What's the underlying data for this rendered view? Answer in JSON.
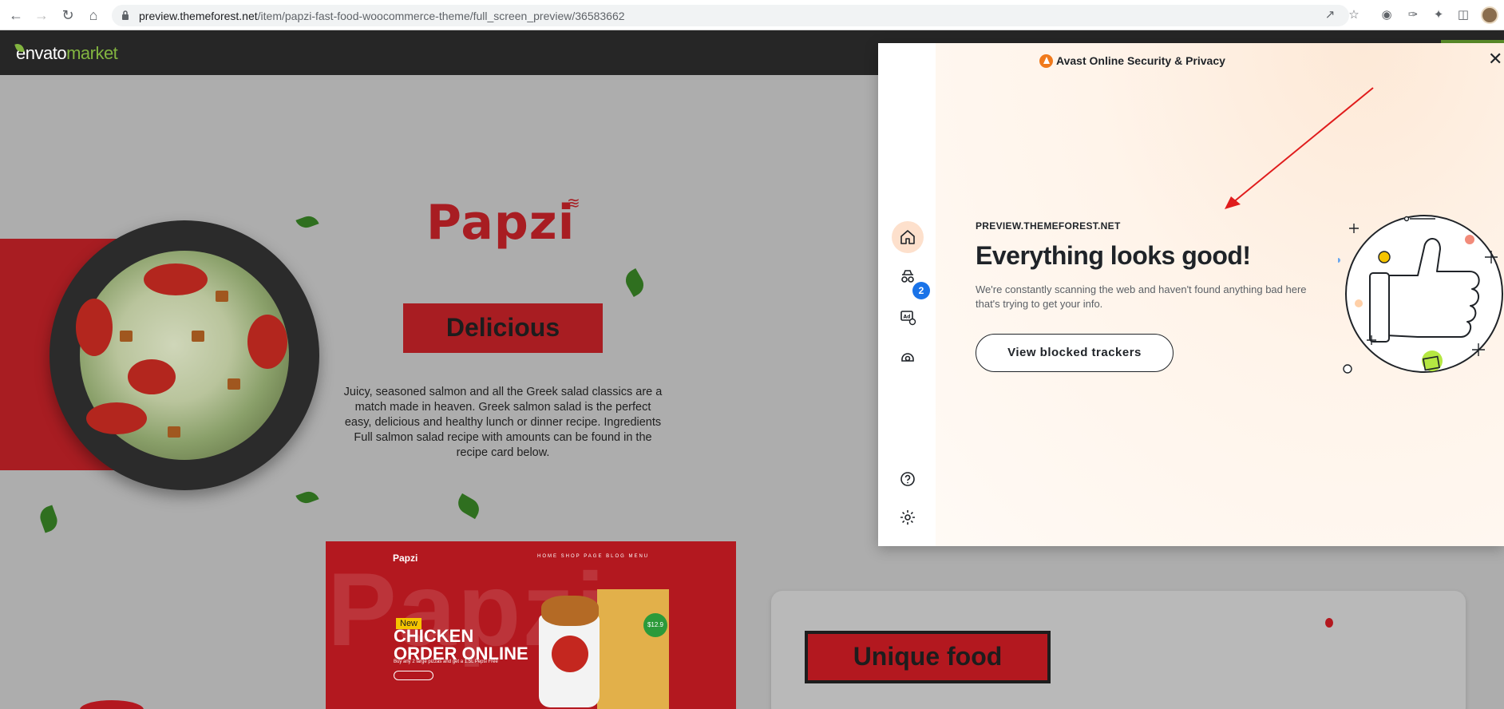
{
  "browser": {
    "url_host": "preview.themeforest.net",
    "url_path": "/item/papzi-fast-food-woocommerce-theme/full_screen_preview/36583662",
    "icons": [
      "back-icon",
      "forward-icon",
      "reload-icon",
      "home-icon",
      "lock-icon",
      "share-icon",
      "star-icon",
      "camera-icon",
      "eyedropper-icon",
      "extensions-icon",
      "sidebar-icon",
      "profile-avatar"
    ]
  },
  "envato": {
    "logo_left": "envato",
    "logo_right": "market"
  },
  "page": {
    "brand": "Papzi",
    "delicious": "Delicious",
    "description": "Juicy, seasoned salmon and all the Greek salad classics are a match made in heaven. Greek salmon salad is the perfect easy, delicious and healthy lunch or dinner recipe. Ingredients Full salmon salad recipe with amounts can be found in the recipe card below.",
    "unique": "Unique food",
    "thumbnail": {
      "logo": "Papzi",
      "nav": "HOME SHOP PAGE BLOG MENU",
      "badge_new": "New",
      "headline_1": "CHICKEN",
      "headline_2": "ORDER ONLINE",
      "subtext": "Buy any 2 large pizzas and get a 1.5L Pepsi Free",
      "price": "$12.9"
    }
  },
  "avast": {
    "title": "Avast Online Security & Privacy",
    "domain": "PREVIEW.THEMEFOREST.NET",
    "headline_start": "Everything ",
    "headline_highlight": "looks good!",
    "body": "We're constantly scanning the web and haven't found anything bad here that's trying to get your info.",
    "button": "View blocked trackers",
    "badge_count": "2",
    "accent": "#c9f06b",
    "sidebar_icons": [
      "home-icon",
      "incognito-icon",
      "ad-block-icon",
      "tracker-icon",
      "help-icon",
      "settings-icon"
    ]
  },
  "colors": {
    "papzi_red": "#a81d22",
    "envato_green": "#82b440",
    "avast_orange": "#f07a1c",
    "badge_blue": "#1a73e8"
  }
}
